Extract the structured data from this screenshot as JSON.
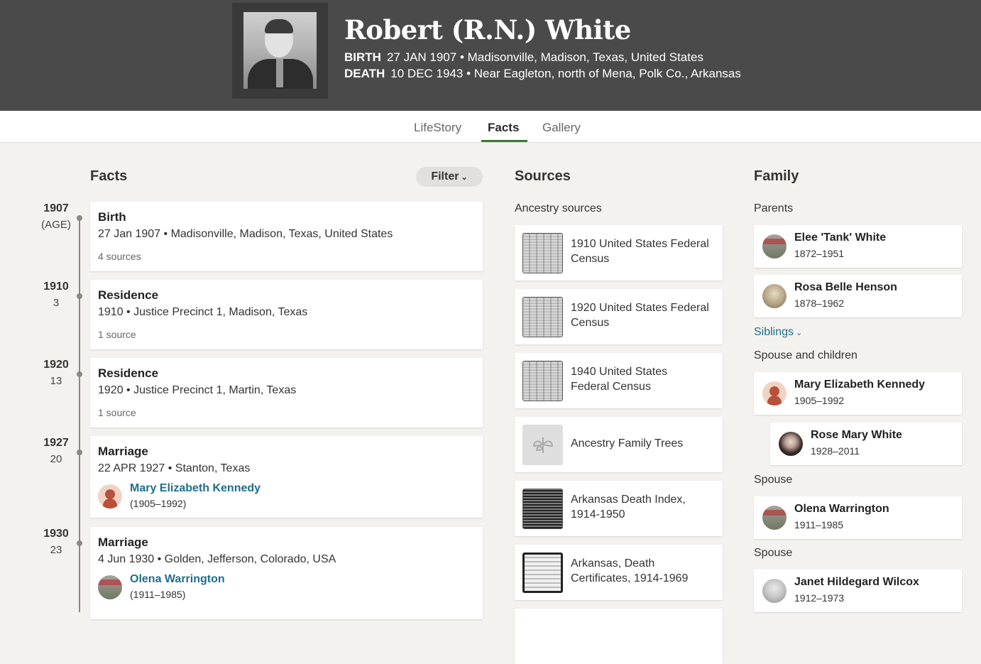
{
  "header": {
    "name": "Robert (R.N.) White",
    "birth_label": "BIRTH",
    "birth_value": "27 JAN 1907 • Madisonville, Madison, Texas, United States",
    "death_label": "DEATH",
    "death_value": "10 DEC 1943 • Near Eagleton, north of Mena, Polk Co., Arkansas"
  },
  "tabs": [
    "LifeStory",
    "Facts",
    "Gallery"
  ],
  "active_tab": "Facts",
  "facts": {
    "title": "Facts",
    "filter_label": "Filter",
    "items": [
      {
        "year": "1907",
        "age": "(AGE)",
        "type": "Birth",
        "detail": "27 Jan 1907 • Madisonville, Madison, Texas, United States",
        "sources": "4 sources"
      },
      {
        "year": "1910",
        "age": "3",
        "type": "Residence",
        "detail": "1910 • Justice Precinct 1, Madison, Texas",
        "sources": "1 source"
      },
      {
        "year": "1920",
        "age": "13",
        "type": "Residence",
        "detail": "1920 • Justice Precinct 1, Martin, Texas",
        "sources": "1 source"
      },
      {
        "year": "1927",
        "age": "20",
        "type": "Marriage",
        "detail": "22 APR 1927 • Stanton, Texas",
        "spouse": "Mary Elizabeth Kennedy",
        "spouse_years": "(1905–1992)",
        "avatar": "silhouette-icon"
      },
      {
        "year": "1930",
        "age": "23",
        "type": "Marriage",
        "detail": "4 Jun 1930 • Golden, Jefferson, Colorado, USA",
        "spouse": "Olena Warrington",
        "spouse_years": "(1911–1985)",
        "avatar": "gravestone-photo"
      }
    ]
  },
  "sources": {
    "title": "Sources",
    "subtitle": "Ancestry sources",
    "items": [
      {
        "line1": "1910 United States Federal",
        "line2": "Census"
      },
      {
        "line1": "1920 United States Federal",
        "line2": "Census"
      },
      {
        "line1": "1940 United States",
        "line2": "Federal Census"
      },
      {
        "line1": "Ancestry Family Trees",
        "line2": ""
      },
      {
        "line1": "Arkansas Death Index,",
        "line2": "1914-1950"
      },
      {
        "line1": "Arkansas, Death",
        "line2": "Certificates, 1914-1969"
      }
    ]
  },
  "family": {
    "title": "Family",
    "parents_label": "Parents",
    "parents": [
      {
        "name": "Elee 'Tank' White",
        "years": "1872–1951"
      },
      {
        "name": "Rosa Belle Henson",
        "years": "1878–1962"
      }
    ],
    "siblings_label": "Siblings",
    "spouse_children_label": "Spouse and children",
    "spouse1": {
      "name": "Mary Elizabeth Kennedy",
      "years": "1905–1992"
    },
    "child1": {
      "name": "Rose Mary White",
      "years": "1928–2011"
    },
    "spouse_label": "Spouse",
    "spouse2": {
      "name": "Olena Warrington",
      "years": "1911–1985"
    },
    "spouse3": {
      "name": "Janet Hildegard Wilcox",
      "years": "1912–1973"
    }
  }
}
